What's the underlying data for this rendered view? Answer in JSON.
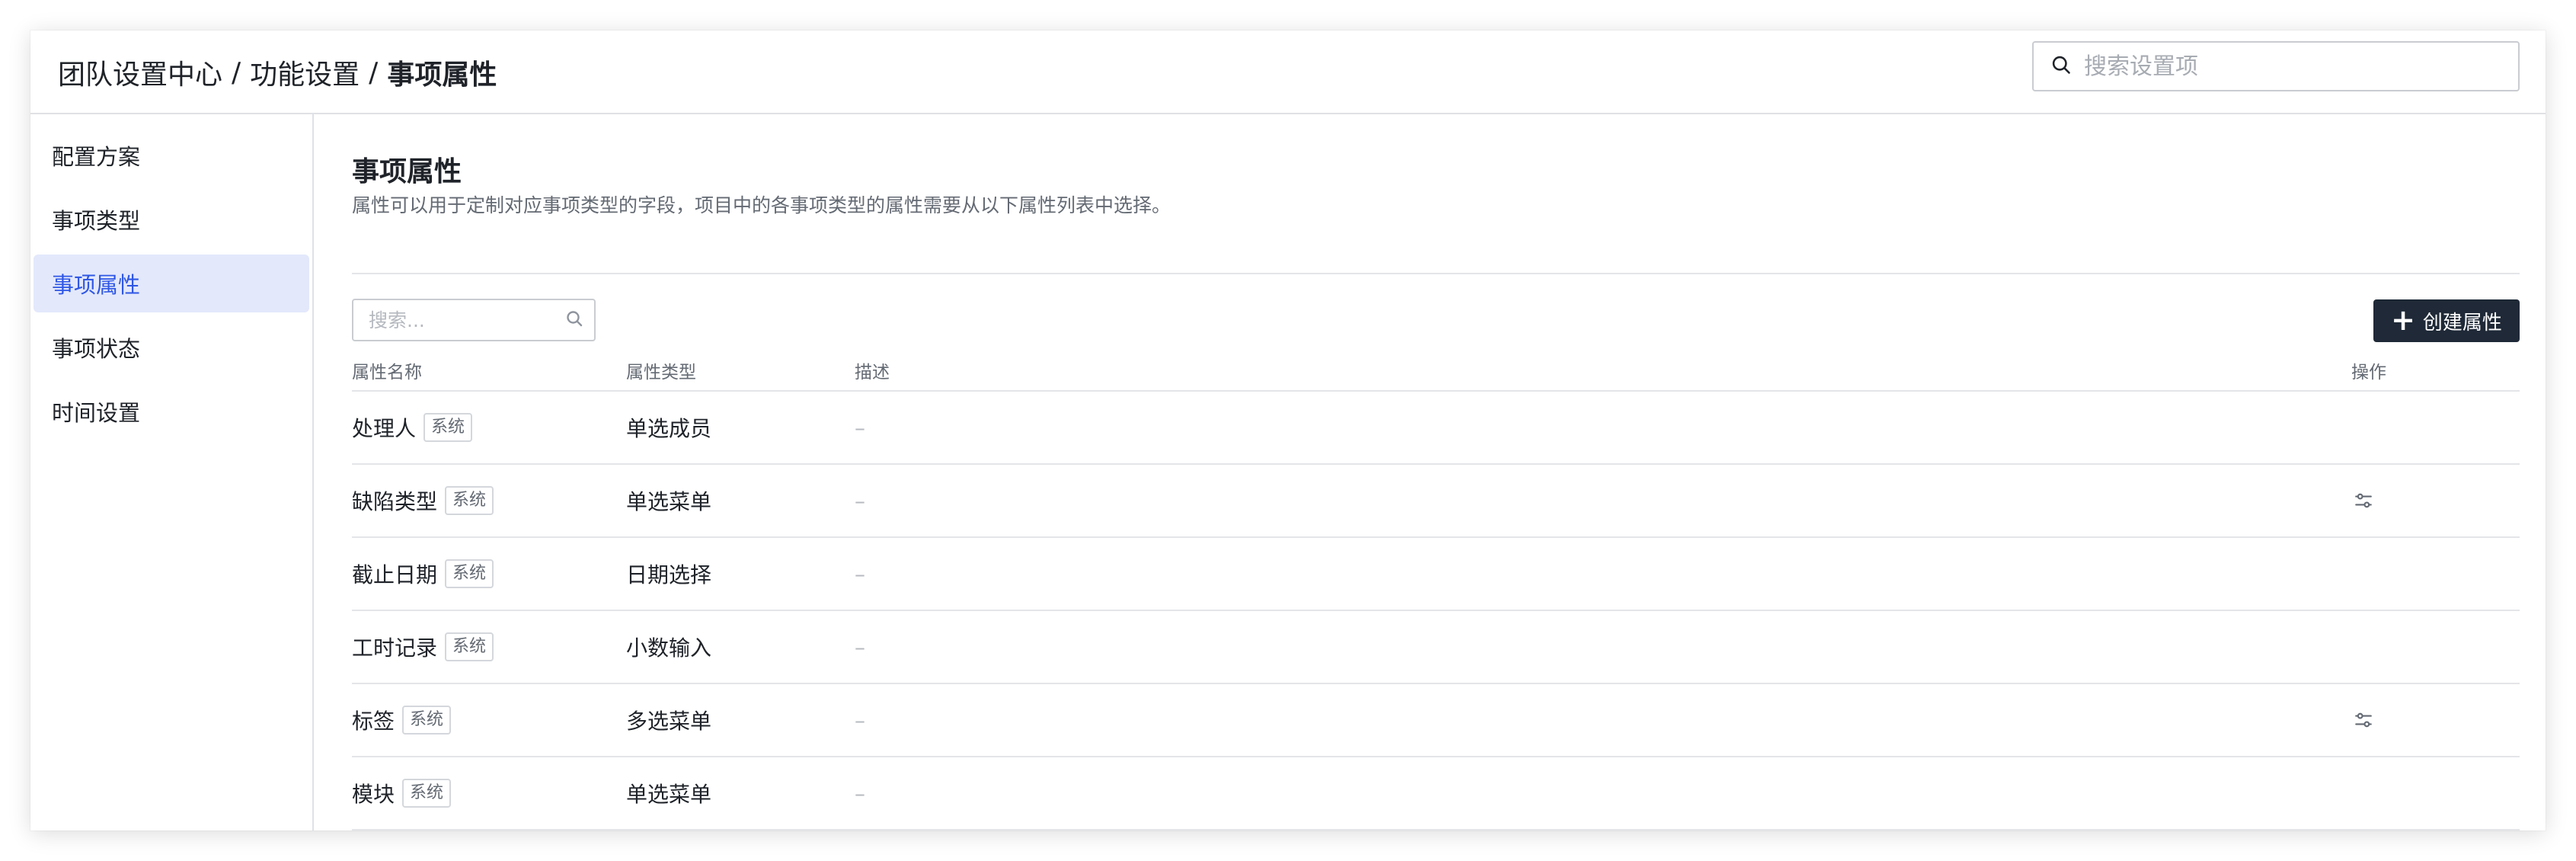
{
  "header": {
    "breadcrumb": [
      "团队设置中心",
      "功能设置",
      "事项属性"
    ],
    "separator": "/",
    "search_placeholder": "搜索设置项"
  },
  "sidebar": {
    "items": [
      {
        "label": "配置方案",
        "active": false
      },
      {
        "label": "事项类型",
        "active": false
      },
      {
        "label": "事项属性",
        "active": true
      },
      {
        "label": "事项状态",
        "active": false
      },
      {
        "label": "时间设置",
        "active": false
      }
    ]
  },
  "main": {
    "title": "事项属性",
    "description": "属性可以用于定制对应事项类型的字段，项目中的各事项类型的属性需要从以下属性列表中选择。",
    "search_placeholder": "搜索...",
    "create_button": "创建属性",
    "table": {
      "headers": {
        "name": "属性名称",
        "type": "属性类型",
        "desc": "描述",
        "op": "操作"
      },
      "rows": [
        {
          "name": "处理人",
          "tag": "系统",
          "type": "单选成员",
          "desc": "–",
          "has_op": false
        },
        {
          "name": "缺陷类型",
          "tag": "系统",
          "type": "单选菜单",
          "desc": "–",
          "has_op": true
        },
        {
          "name": "截止日期",
          "tag": "系统",
          "type": "日期选择",
          "desc": "–",
          "has_op": false
        },
        {
          "name": "工时记录",
          "tag": "系统",
          "type": "小数输入",
          "desc": "–",
          "has_op": false
        },
        {
          "name": "标签",
          "tag": "系统",
          "type": "多选菜单",
          "desc": "–",
          "has_op": true
        },
        {
          "name": "模块",
          "tag": "系统",
          "type": "单选菜单",
          "desc": "–",
          "has_op": false
        }
      ]
    }
  },
  "icons": {
    "search": "search-icon",
    "plus": "plus-icon",
    "settings": "sliders-icon"
  },
  "colors": {
    "accent": "#2f57e5",
    "active_bg": "#e3e8fb",
    "primary_button": "#1f2937"
  }
}
